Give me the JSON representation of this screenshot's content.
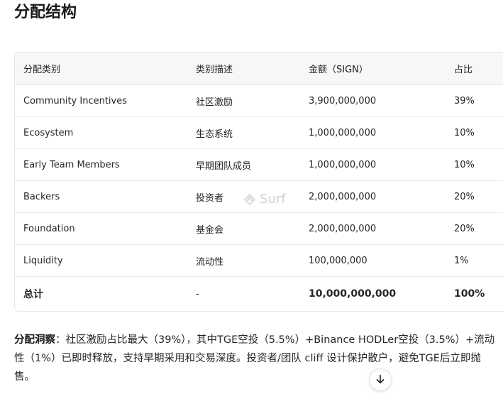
{
  "page": {
    "title": "分配结构"
  },
  "table": {
    "headers": [
      "分配类别",
      "类别描述",
      "金额（SIGN）",
      "占比"
    ],
    "rows": [
      [
        "Community Incentives",
        "社区激励",
        "3,900,000,000",
        "39%"
      ],
      [
        "Ecosystem",
        "生态系统",
        "1,000,000,000",
        "10%"
      ],
      [
        "Early Team Members",
        "早期团队成员",
        "1,000,000,000",
        "10%"
      ],
      [
        "Backers",
        "投资者",
        "2,000,000,000",
        "20%"
      ],
      [
        "Foundation",
        "基金会",
        "2,000,000,000",
        "20%"
      ],
      [
        "Liquidity",
        "流动性",
        "100,000,000",
        "1%"
      ]
    ],
    "total": [
      "总计",
      "-",
      "10,000,000,000",
      "100%"
    ]
  },
  "watermark": {
    "text": "Surf",
    "icon": "surf-logo-icon"
  },
  "insight": {
    "label": "分配洞察",
    "text": "：社区激励占比最大（39%），其中TGE空投（5.5%）+Binance HODLer空投（3.5%）+流动性（1%）已即时释放，支持早期采用和交易深度。投资者/团队 cliff 设计保护散户，避免TGE后立即抛售。"
  },
  "scroll_button": {
    "icon": "arrow-down-icon"
  }
}
